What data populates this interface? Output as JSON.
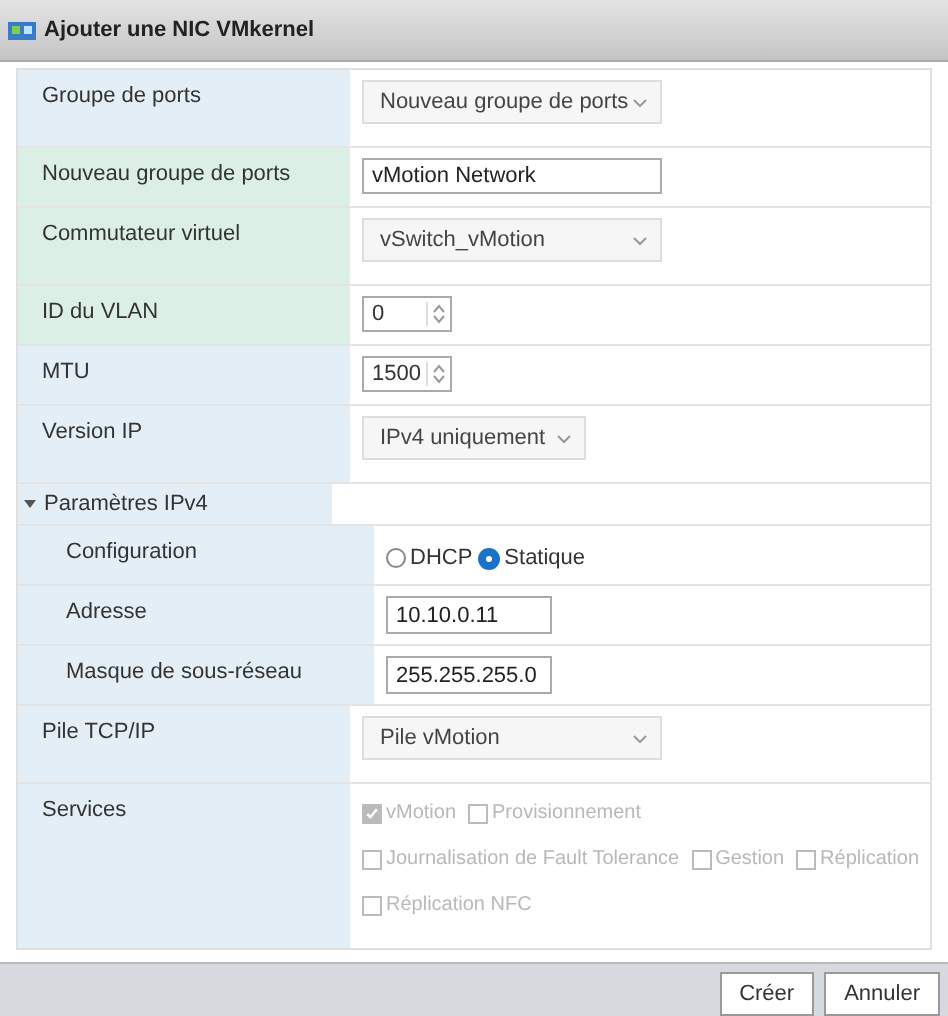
{
  "window": {
    "title": "Ajouter une NIC VMkernel"
  },
  "rows": [
    {
      "kind": "select",
      "label": "Groupe de ports",
      "value": "Nouveau groupe de ports",
      "highlighted": false,
      "indented": false
    },
    {
      "kind": "text",
      "label": "Nouveau groupe de ports",
      "value": "vMotion Network",
      "highlighted": true,
      "indented": false
    },
    {
      "kind": "select",
      "label": "Commutateur virtuel",
      "value": "vSwitch_vMotion",
      "highlighted": true,
      "indented": false
    },
    {
      "kind": "spinner",
      "label": "ID du VLAN",
      "value": "0",
      "highlighted": true,
      "indented": false
    },
    {
      "kind": "spinner",
      "label": "MTU",
      "value": "1500",
      "highlighted": false,
      "indented": false
    },
    {
      "kind": "select-short",
      "label": "Version IP",
      "value": "IPv4 uniquement",
      "highlighted": false,
      "indented": false
    },
    {
      "kind": "section",
      "label": "Paramètres IPv4",
      "expanded": true,
      "highlighted": false,
      "indented": false
    },
    {
      "kind": "radio",
      "label": "Configuration",
      "options": [
        {
          "label": "DHCP",
          "selected": false
        },
        {
          "label": "Statique",
          "selected": true
        }
      ],
      "highlighted": false,
      "indented": true
    },
    {
      "kind": "text-short",
      "label": "Adresse",
      "value": "10.10.0.11",
      "highlighted": false,
      "indented": true
    },
    {
      "kind": "text-short",
      "label": "Masque de sous-réseau",
      "value": "255.255.255.0",
      "highlighted": false,
      "indented": true
    },
    {
      "kind": "select",
      "label": "Pile TCP/IP",
      "value": "Pile vMotion",
      "highlighted": false,
      "indented": false
    },
    {
      "kind": "checkboxes",
      "label": "Services",
      "disabled": true,
      "lines": [
        [
          {
            "label": "vMotion",
            "checked": true
          },
          {
            "label": "Provisionnement",
            "checked": false
          }
        ],
        [
          {
            "label": "Journalisation de Fault Tolerance",
            "checked": false
          },
          {
            "label": "Gestion",
            "checked": false
          },
          {
            "label": "Réplication",
            "checked": false
          }
        ],
        [
          {
            "label": "Réplication NFC",
            "checked": false
          }
        ]
      ],
      "highlighted": false,
      "indented": false
    }
  ],
  "buttons": [
    "Créer",
    "Annuler"
  ]
}
